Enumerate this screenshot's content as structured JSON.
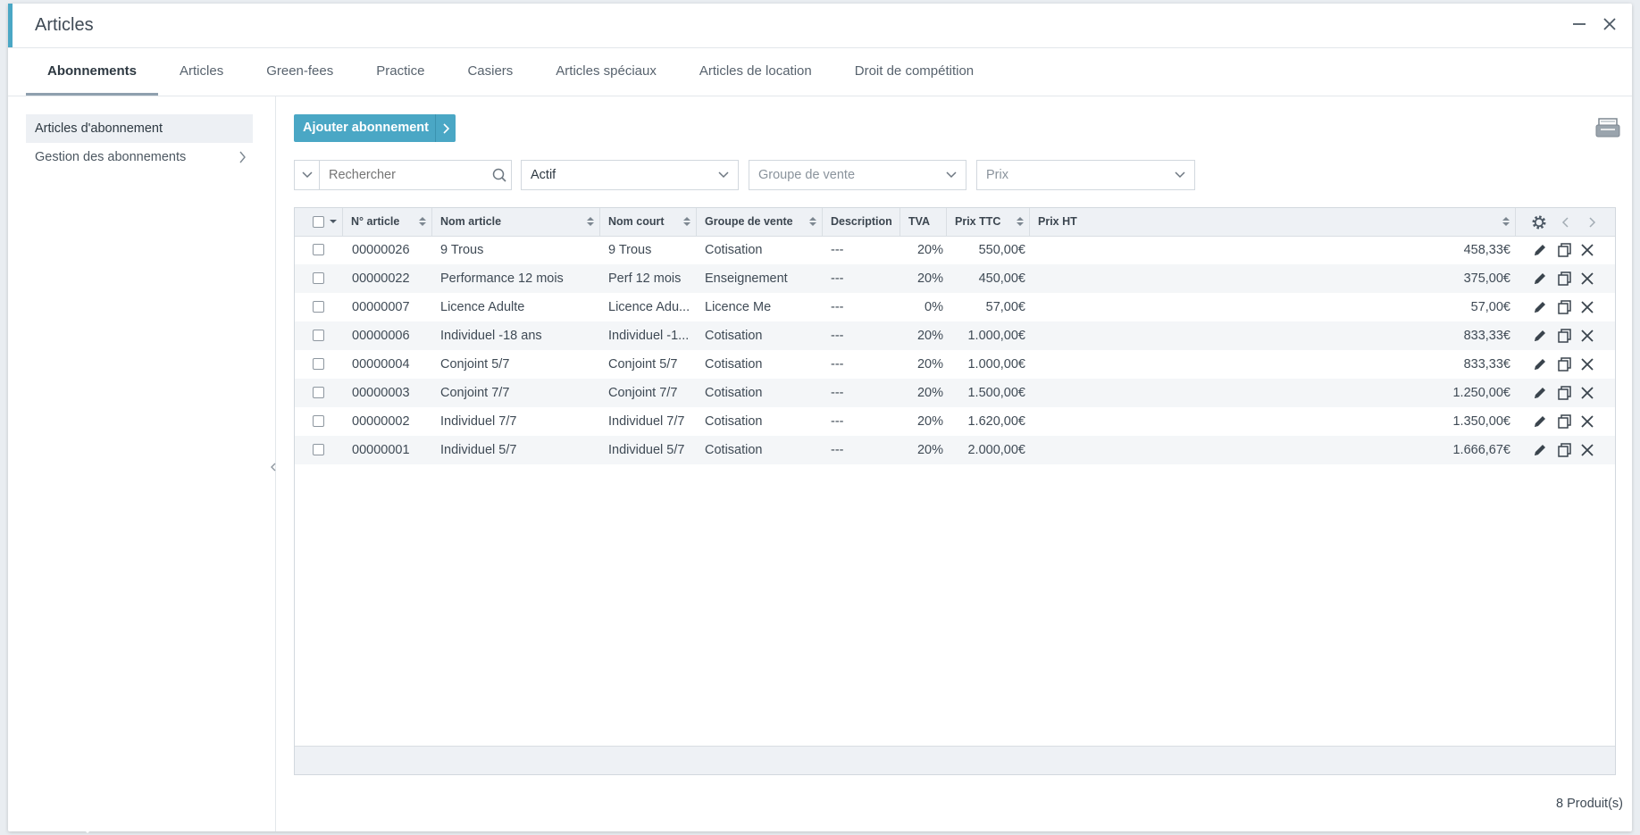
{
  "window": {
    "title": "Articles"
  },
  "tabs": [
    {
      "label": "Abonnements",
      "active": true
    },
    {
      "label": "Articles"
    },
    {
      "label": "Green-fees"
    },
    {
      "label": "Practice"
    },
    {
      "label": "Casiers"
    },
    {
      "label": "Articles spéciaux"
    },
    {
      "label": "Articles de location"
    },
    {
      "label": "Droit de compétition"
    }
  ],
  "sidebar": {
    "items": [
      {
        "label": "Articles d'abonnement",
        "active": true
      },
      {
        "label": "Gestion des abonnements"
      }
    ]
  },
  "toolbar": {
    "add_label": "Ajouter abonnement"
  },
  "filters": {
    "search_placeholder": "Rechercher",
    "status_value": "Actif",
    "group_placeholder": "Groupe de vente",
    "price_placeholder": "Prix"
  },
  "table": {
    "columns": [
      "N° article",
      "Nom article",
      "Nom court",
      "Groupe de vente",
      "Description",
      "TVA",
      "Prix TTC",
      "Prix HT"
    ],
    "rows": [
      [
        "00000026",
        "9 Trous",
        "9 Trous",
        "Cotisation",
        "---",
        "20%",
        "550,00€",
        "458,33€"
      ],
      [
        "00000022",
        "Performance 12 mois",
        "Perf 12 mois",
        "Enseignement",
        "---",
        "20%",
        "450,00€",
        "375,00€"
      ],
      [
        "00000007",
        "Licence Adulte",
        "Licence Adu...",
        "Licence Me",
        "---",
        "0%",
        "57,00€",
        "57,00€"
      ],
      [
        "00000006",
        "Individuel -18 ans",
        "Individuel -1...",
        "Cotisation",
        "---",
        "20%",
        "1.000,00€",
        "833,33€"
      ],
      [
        "00000004",
        "Conjoint 5/7",
        "Conjoint 5/7",
        "Cotisation",
        "---",
        "20%",
        "1.000,00€",
        "833,33€"
      ],
      [
        "00000003",
        "Conjoint 7/7",
        "Conjoint 7/7",
        "Cotisation",
        "---",
        "20%",
        "1.500,00€",
        "1.250,00€"
      ],
      [
        "00000002",
        "Individuel 7/7",
        "Individuel 7/7",
        "Cotisation",
        "---",
        "20%",
        "1.620,00€",
        "1.350,00€"
      ],
      [
        "00000001",
        "Individuel 5/7",
        "Individuel 5/7",
        "Cotisation",
        "---",
        "20%",
        "2.000,00€",
        "1.666,67€"
      ]
    ]
  },
  "footer": {
    "count": "8 Produit(s)"
  },
  "colors": {
    "accent": "#4aa7c5",
    "header_bg": "#eef1f5",
    "stripe": "#f4f6f8"
  },
  "icons": [
    "minimize-icon",
    "close-icon",
    "printer-icon",
    "search-icon",
    "chevron-down-icon",
    "gear-icon",
    "edit-icon",
    "copy-icon",
    "delete-icon"
  ]
}
